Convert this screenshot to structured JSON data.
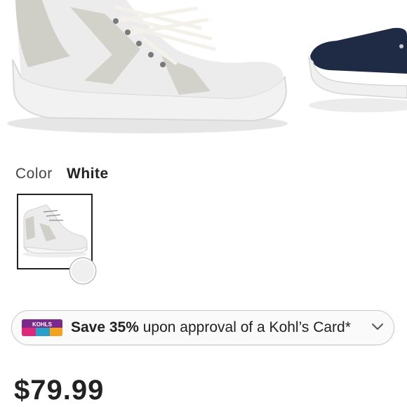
{
  "product": {
    "color_label": "Color",
    "color_value": "White",
    "price": "$79.99"
  },
  "promo": {
    "bold_text": "Save 35%",
    "rest_text": " upon approval of a Kohl’s Card*",
    "card_logo_text": "KOHLS"
  },
  "colors": {
    "accent_text": "#222222",
    "swatch_border": "#222222"
  }
}
